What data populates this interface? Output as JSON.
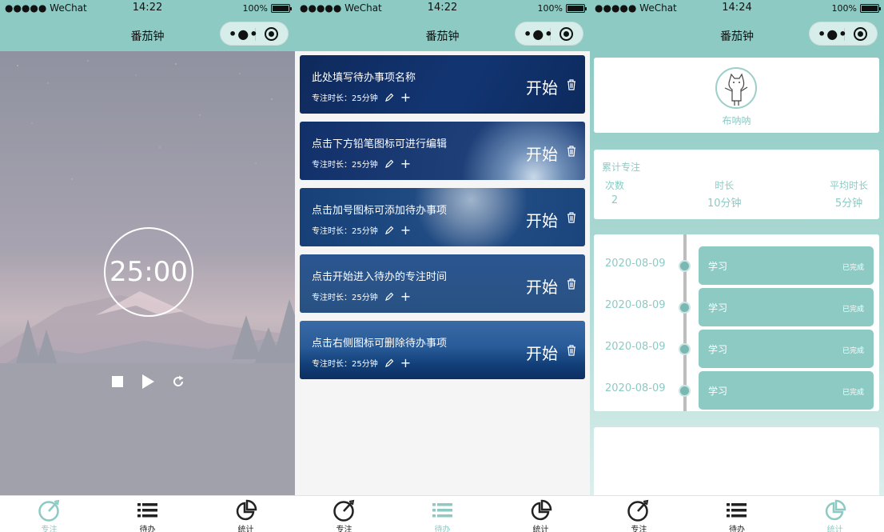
{
  "status_bar": {
    "carrier": "●●●●● WeChat",
    "battery_text": "100%"
  },
  "screens": [
    {
      "time": "14:22",
      "nav_title": "番茄钟",
      "focus": {
        "timer": "25:00"
      },
      "active_tab": 0
    },
    {
      "time": "14:22",
      "nav_title": "番茄钟",
      "todos": [
        {
          "name": "此处填写待办事项名称",
          "duration": "专注时长：25分钟",
          "start_label": "开始"
        },
        {
          "name": "点击下方铅笔图标可进行编辑",
          "duration": "专注时长：25分钟",
          "start_label": "开始"
        },
        {
          "name": "点击加号图标可添加待办事项",
          "duration": "专注时长：25分钟",
          "start_label": "开始"
        },
        {
          "name": "点击开始进入待办的专注时间",
          "duration": "专注时长：25分钟",
          "start_label": "开始"
        },
        {
          "name": "点击右侧图标可删除待办事项",
          "duration": "专注时长：25分钟",
          "start_label": "开始"
        }
      ],
      "active_tab": 1
    },
    {
      "time": "14:24",
      "nav_title": "番茄钟",
      "profile": {
        "nickname": "布呐呐"
      },
      "summary": {
        "heading": "累计专注",
        "stats": [
          {
            "label": "次数",
            "value": "2"
          },
          {
            "label": "时长",
            "value": "10分钟"
          },
          {
            "label": "平均时长",
            "value": "5分钟"
          }
        ]
      },
      "history": [
        {
          "date": "2020-08-09",
          "label": "学习",
          "status": "已完成"
        },
        {
          "date": "2020-08-09",
          "label": "学习",
          "status": "已完成"
        },
        {
          "date": "2020-08-09",
          "label": "学习",
          "status": "已完成"
        },
        {
          "date": "2020-08-09",
          "label": "学习",
          "status": "已完成"
        }
      ],
      "active_tab": 2
    }
  ],
  "tabs": [
    {
      "label": "专注",
      "icon": "focus-clock-icon"
    },
    {
      "label": "待办",
      "icon": "list-icon"
    },
    {
      "label": "统计",
      "icon": "pie-chart-icon"
    }
  ],
  "colors": {
    "theme": "#8dcac4",
    "tab_inactive": "#222222"
  }
}
